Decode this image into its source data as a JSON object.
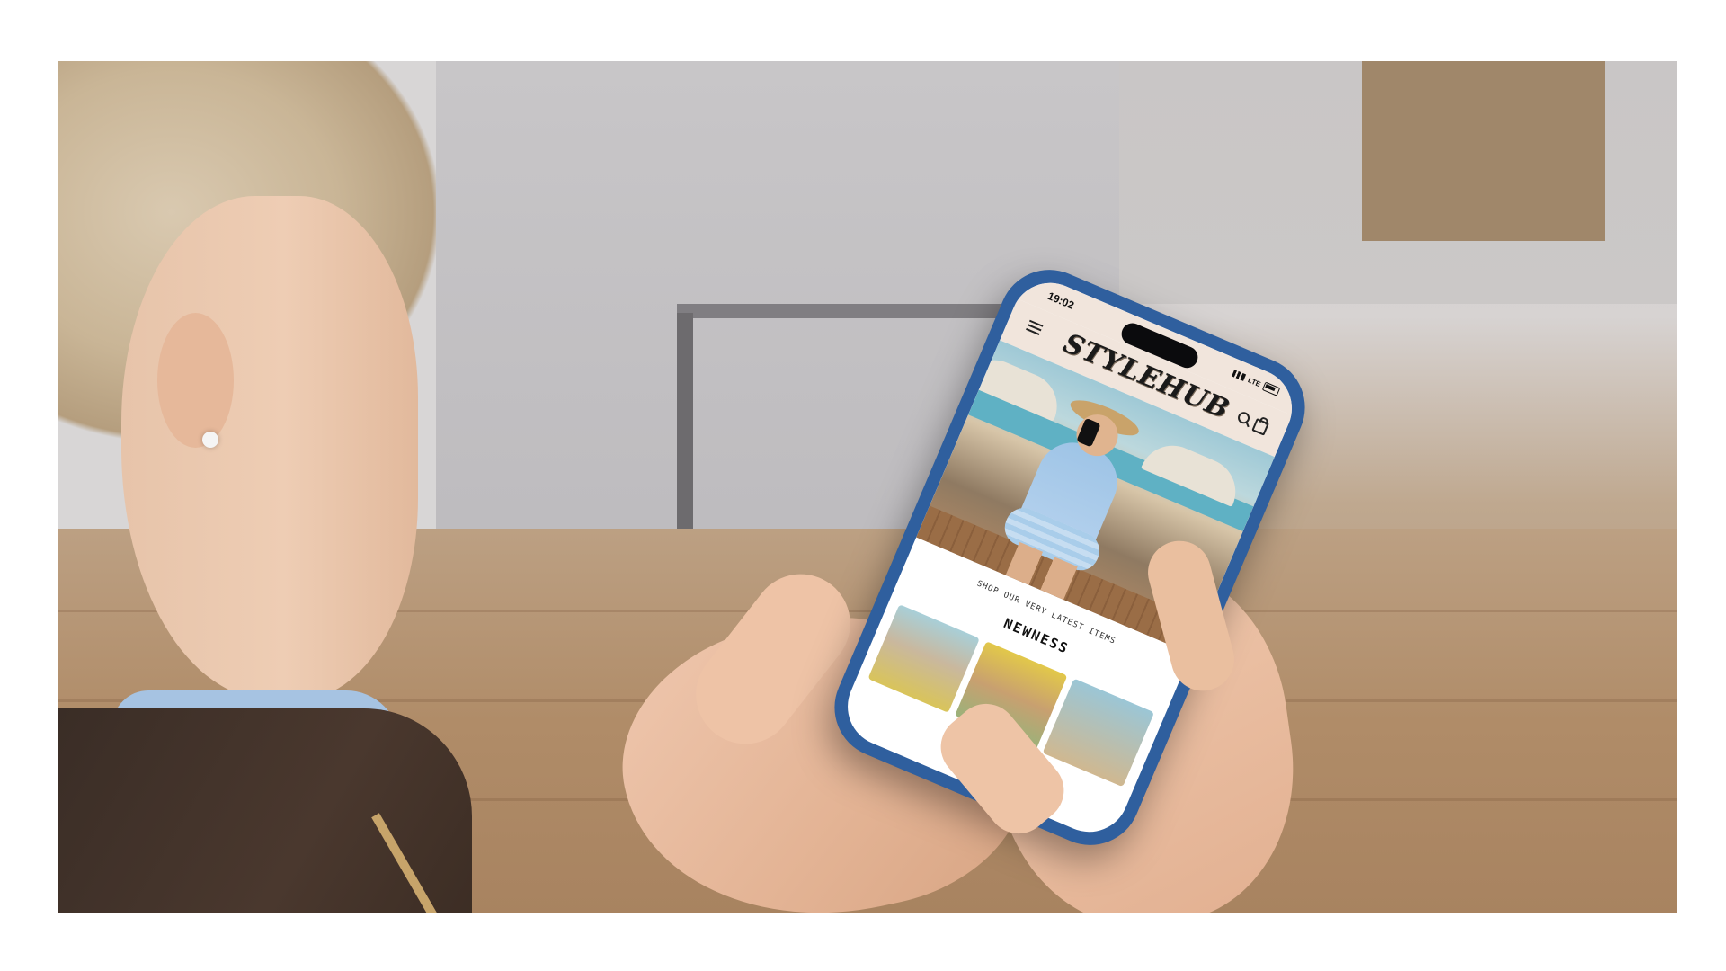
{
  "status_bar": {
    "time": "19:02",
    "network": "LTE"
  },
  "app": {
    "brand": "STYLEHUB",
    "section_subtitle": "SHOP OUR VERY LATEST ITEMS",
    "section_title": "NEWNESS",
    "icons": {
      "menu": "hamburger-menu-icon",
      "search": "search-icon",
      "cart": "shopping-bag-icon"
    }
  },
  "colors": {
    "phone_case": "#2f5f9e",
    "header_bg": "#f1e5dc"
  }
}
